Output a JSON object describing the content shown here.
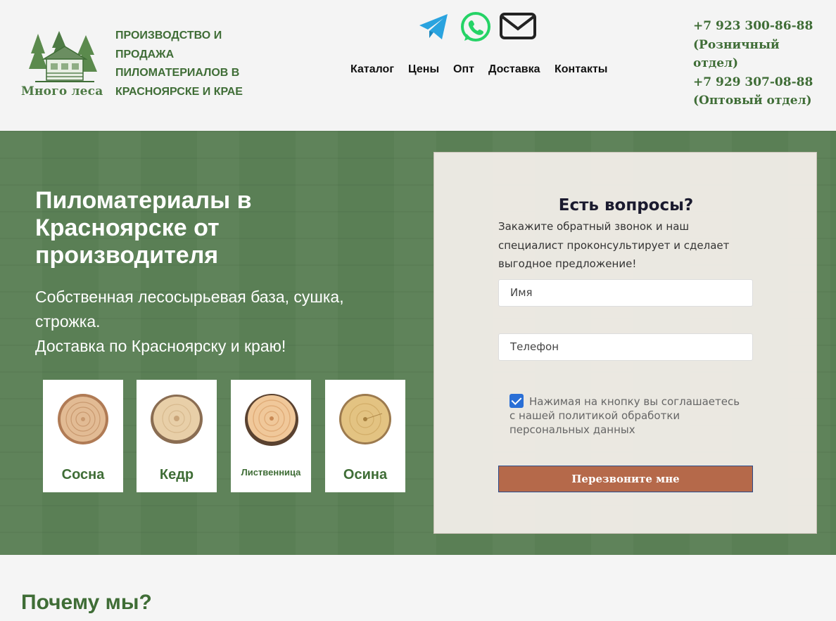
{
  "brand": {
    "logo_text": "Много леса",
    "tagline": [
      "ПРОИЗВОДСТВО И",
      "ПРОДАЖА",
      "ПИЛОМАТЕРИАЛОВ В",
      "КРАСНОЯРСКЕ И КРАЕ"
    ]
  },
  "socials": [
    {
      "name": "telegram-icon",
      "color": "#2aa3df"
    },
    {
      "name": "whatsapp-icon",
      "color": "#25d366"
    },
    {
      "name": "email-icon",
      "color": "#222222"
    }
  ],
  "nav": [
    "Каталог",
    "Цены",
    "Опт",
    "Доставка",
    "Контакты"
  ],
  "phones": [
    "+7 923 300-86-88",
    "(Розничный",
    "отдел)",
    "+7 929 307-08-88",
    "(Оптовый отдел)"
  ],
  "hero": {
    "title": "Пиломатериалы в Красноярске от производителя",
    "subtitle_line1": "Собственная лесосырьевая база, сушка, строжка.",
    "subtitle_line2": "Доставка по Красноярску и краю!",
    "background_color": "#5a7f55"
  },
  "wood_types": [
    {
      "label": "Сосна",
      "icon": "pine-wood-slice-icon"
    },
    {
      "label": "Кедр",
      "icon": "cedar-wood-slice-icon"
    },
    {
      "label": "Лиственница",
      "icon": "larch-wood-slice-icon"
    },
    {
      "label": "Осина",
      "icon": "aspen-wood-slice-icon"
    }
  ],
  "form": {
    "title": "Есть вопросы?",
    "description": "Закажите обратный звонок и наш специалист проконсультирует и сделает выгодное предложение!",
    "name_placeholder": "Имя",
    "phone_placeholder": "Телефон",
    "consent_checked": true,
    "consent_text": "Нажимая на кнопку вы соглашаетесь с нашей политикой обработки персональных данных",
    "submit_label": "Перезвоните мне",
    "button_color": "#b5694a"
  },
  "sections": {
    "why_title": "Почему мы?"
  },
  "colors": {
    "brand_green": "#3f6d36",
    "header_bg": "#f4f4f4"
  }
}
